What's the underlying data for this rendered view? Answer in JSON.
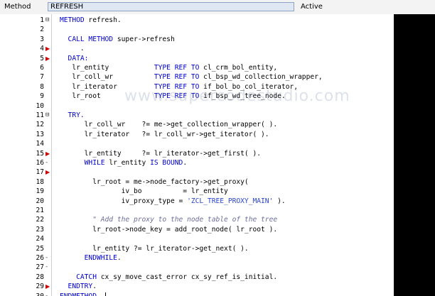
{
  "header": {
    "method_label": "Method",
    "method_value": "REFRESH",
    "status": "Active"
  },
  "watermark": "www.supercodestudio.com",
  "editor": {
    "line_numbers": [
      "1",
      "2",
      "3",
      "4",
      "5",
      "6",
      "7",
      "8",
      "9",
      "10",
      "11",
      "12",
      "13",
      "14",
      "15",
      "16",
      "17",
      "18",
      "19",
      "20",
      "21",
      "22",
      "23",
      "24",
      "25",
      "26",
      "27",
      "28",
      "29",
      "30"
    ],
    "lines": [
      [
        {
          "t": "METHOD",
          "c": "kw"
        },
        {
          "t": " refresh.",
          "c": ""
        }
      ],
      [],
      [
        {
          "t": "  CALL METHOD",
          "c": "kw"
        },
        {
          "t": " super->refresh",
          "c": ""
        }
      ],
      [
        {
          "t": "     .",
          "c": ""
        }
      ],
      [
        {
          "t": "  DATA:",
          "c": "kw"
        }
      ],
      [
        {
          "t": "   lr_entity           ",
          "c": ""
        },
        {
          "t": "TYPE REF TO",
          "c": "kw"
        },
        {
          "t": " cl_crm_bol_entity,",
          "c": ""
        }
      ],
      [
        {
          "t": "   lr_coll_wr          ",
          "c": ""
        },
        {
          "t": "TYPE REF TO",
          "c": "kw"
        },
        {
          "t": " cl_bsp_wd_collection_wrapper,",
          "c": ""
        }
      ],
      [
        {
          "t": "   lr_iterator         ",
          "c": ""
        },
        {
          "t": "TYPE REF TO",
          "c": "kw"
        },
        {
          "t": " if_bol_bo_col_iterator,",
          "c": ""
        }
      ],
      [
        {
          "t": "   lr_root             ",
          "c": ""
        },
        {
          "t": "TYPE REF TO",
          "c": "kw"
        },
        {
          "t": " if_bsp_wd_tree_node.",
          "c": ""
        }
      ],
      [],
      [
        {
          "t": "  TRY.",
          "c": "kw"
        }
      ],
      [
        {
          "t": "      lr_coll_wr    ?= me->get_collection_wrapper( ).",
          "c": ""
        }
      ],
      [
        {
          "t": "      lr_iterator   ?= lr_coll_wr->get_iterator( ).",
          "c": ""
        }
      ],
      [],
      [
        {
          "t": "      lr_entity     ?= lr_iterator->get_first( ).",
          "c": ""
        }
      ],
      [
        {
          "t": "      WHILE",
          "c": "kw"
        },
        {
          "t": " lr_entity ",
          "c": ""
        },
        {
          "t": "IS BOUND",
          "c": "kw"
        },
        {
          "t": ".",
          "c": ""
        }
      ],
      [],
      [
        {
          "t": "        lr_root = me->node_factory->get_proxy(",
          "c": ""
        }
      ],
      [
        {
          "t": "               iv_bo          = lr_entity",
          "c": ""
        }
      ],
      [
        {
          "t": "               iv_proxy_type = ",
          "c": ""
        },
        {
          "t": "'ZCL_TREE_PROXY_MAIN'",
          "c": "str"
        },
        {
          "t": " ).",
          "c": ""
        }
      ],
      [],
      [
        {
          "t": "        \" Add the proxy to the node table of the tree",
          "c": "cm"
        }
      ],
      [
        {
          "t": "        lr_root->node_key = add_root_node( lr_root ).",
          "c": ""
        }
      ],
      [],
      [
        {
          "t": "        lr_entity ?= lr_iterator->get_next( ).",
          "c": ""
        }
      ],
      [
        {
          "t": "      ENDWHILE",
          "c": "kw"
        },
        {
          "t": ".",
          "c": ""
        }
      ],
      [],
      [
        {
          "t": "    CATCH",
          "c": "kw"
        },
        {
          "t": " cx_sy_move_cast_error cx_sy_ref_is_initial.",
          "c": ""
        }
      ],
      [
        {
          "t": "  ENDTRY",
          "c": "kw"
        },
        {
          "t": ".",
          "c": ""
        }
      ],
      [
        {
          "t": "ENDMETHOD",
          "c": "kw"
        },
        {
          "t": ".",
          "c": ""
        }
      ]
    ],
    "fold_markers": {
      "1": "⊟",
      "11": "⊟"
    },
    "breakpoints": [
      4,
      5,
      15,
      17,
      29
    ],
    "dashes": [
      16,
      26,
      27,
      30
    ]
  }
}
